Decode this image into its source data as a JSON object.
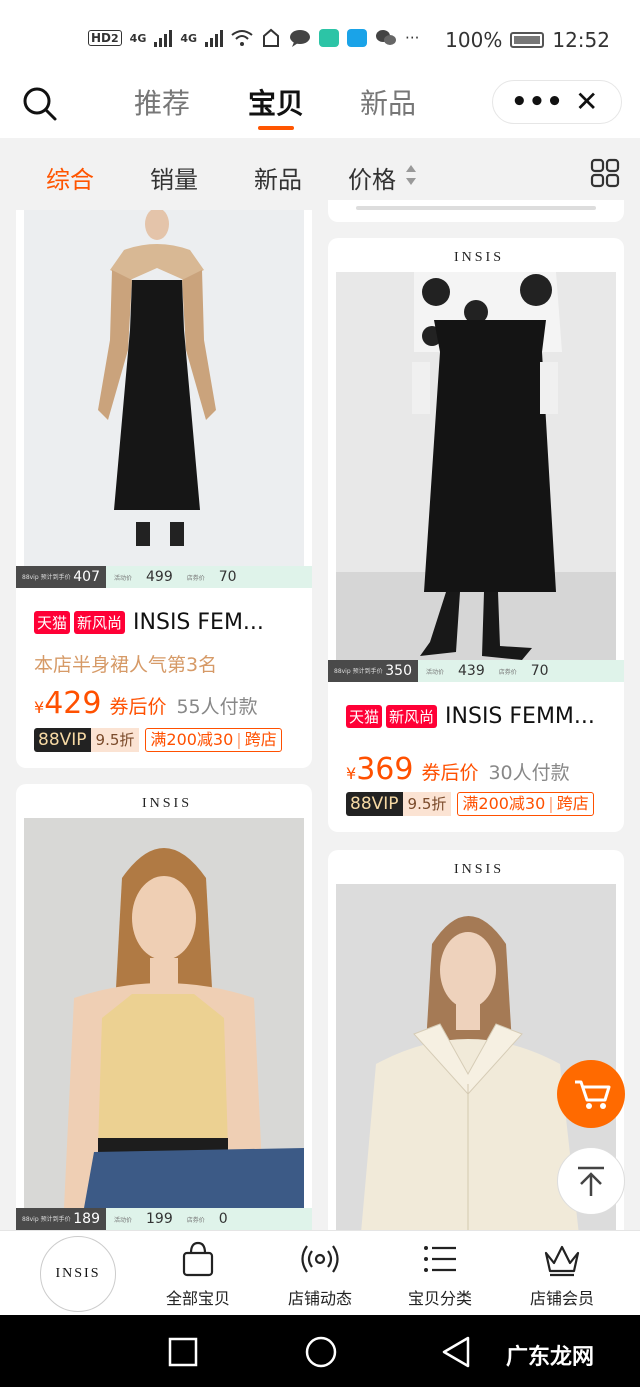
{
  "status_bar": {
    "hd": "HD",
    "hd_sub": "2",
    "sig1": "4G",
    "sig2": "4G",
    "more": "···",
    "battery_pct": "100%",
    "time": "12:52"
  },
  "top_nav": {
    "tabs": [
      "推荐",
      "宝贝",
      "新品"
    ],
    "active_tab": 1,
    "more_label": "•••",
    "close_label": "✕"
  },
  "sort_bar": {
    "items": [
      "综合",
      "销量",
      "新品",
      "价格"
    ],
    "active": 0
  },
  "products": [
    {
      "vip_price": "407",
      "vip_mini": "88vip 预计到手价",
      "promo_price": "499",
      "promo_mini": "活动价",
      "coupon_amt": "70",
      "coupon_mini": "店券价",
      "tags": [
        "天猫",
        "新风尚"
      ],
      "title": "INSIS FEM...",
      "rank": "本店半身裙人气第3名",
      "currency": "¥",
      "price": "429",
      "price_note": "券后价",
      "buyers": "55人付款",
      "vip_badge": "88VIP",
      "discount": "9.5折",
      "coupons": [
        "满200减30",
        "跨店"
      ]
    },
    {
      "vip_price": "350",
      "vip_mini": "88vip 预计到手价",
      "promo_price": "439",
      "promo_mini": "活动价",
      "coupon_amt": "70",
      "coupon_mini": "店券价",
      "tags": [
        "天猫",
        "新风尚"
      ],
      "title": "INSIS FEMM...",
      "currency": "¥",
      "price": "369",
      "price_note": "券后价",
      "buyers": "30人付款",
      "vip_badge": "88VIP",
      "discount": "9.5折",
      "coupons": [
        "满200减30",
        "跨店"
      ]
    },
    {
      "brand": "INSIS",
      "vip_price": "189",
      "vip_mini": "88vip 预计到手价",
      "promo_price": "199",
      "promo_mini": "活动价",
      "coupon_amt": "0",
      "coupon_mini": "店券价"
    },
    {
      "brand": "INSIS"
    }
  ],
  "second_card_brand": "INSIS",
  "bottom_bar": {
    "logo": "INSIS",
    "tabs": [
      "全部宝贝",
      "店铺动态",
      "宝贝分类",
      "店铺会员"
    ]
  },
  "watermark": "广东龙网",
  "colors": {
    "accent": "#ff5500",
    "tmall_red": "#ff0036"
  }
}
